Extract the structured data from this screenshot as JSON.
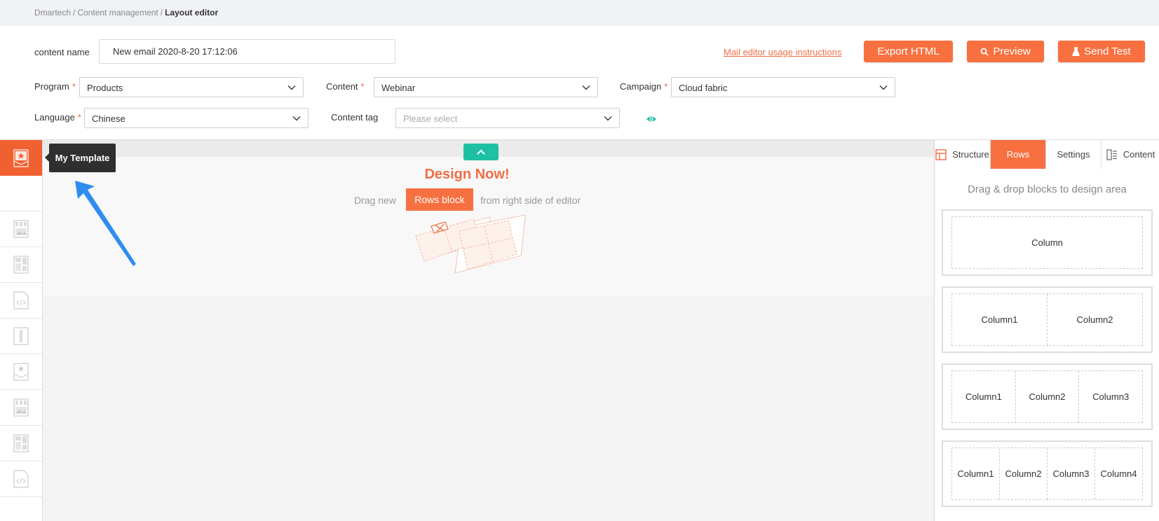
{
  "breadcrumb": {
    "items": [
      "Dmartech",
      "Content management"
    ],
    "current": "Layout editor"
  },
  "form": {
    "content_name_label": "content name",
    "content_name_value": "New email 2020-8-20 17:12:06",
    "program_label": "Program",
    "program_value": "Products",
    "content_label": "Content",
    "content_value": "Webinar",
    "campaign_label": "Campaign",
    "campaign_value": "Cloud fabric",
    "language_label": "Language",
    "language_value": "Chinese",
    "content_tag_label": "Content tag",
    "content_tag_placeholder": "Please select",
    "required_marker": "*"
  },
  "actions": {
    "instructions_link": "Mail editor usage instructions",
    "export_label": "Export HTML",
    "preview_label": "Preview",
    "send_test_label": "Send Test"
  },
  "sidebar": {
    "tooltip": "My Template",
    "active_icon": "template-icon",
    "items": [
      "image-gallery-icon",
      "layout-grid-icon",
      "code-file-icon",
      "column-icon",
      "template-icon",
      "image-gallery-icon",
      "layout-grid-icon",
      "code-file-icon"
    ]
  },
  "canvas": {
    "title": "Design Now!",
    "hint_before": "Drag new",
    "hint_chip": "Rows block",
    "hint_after": "from right side of editor"
  },
  "panel": {
    "tabs": [
      {
        "label": "Structure",
        "icon": "structure-icon"
      },
      {
        "label": "Rows"
      },
      {
        "label": "Settings"
      },
      {
        "label": "Content",
        "icon": "content-icon"
      }
    ],
    "active_tab": "Rows",
    "hint": "Drag & drop blocks to design area",
    "rows": [
      [
        "Column"
      ],
      [
        "Column1",
        "Column2"
      ],
      [
        "Column1",
        "Column2",
        "Column3"
      ],
      [
        "Column1",
        "Column2",
        "Column3",
        "Column4"
      ]
    ]
  },
  "colors": {
    "accent": "#f87040",
    "teal": "#1ec0a4",
    "arrow": "#2f8cf0"
  }
}
